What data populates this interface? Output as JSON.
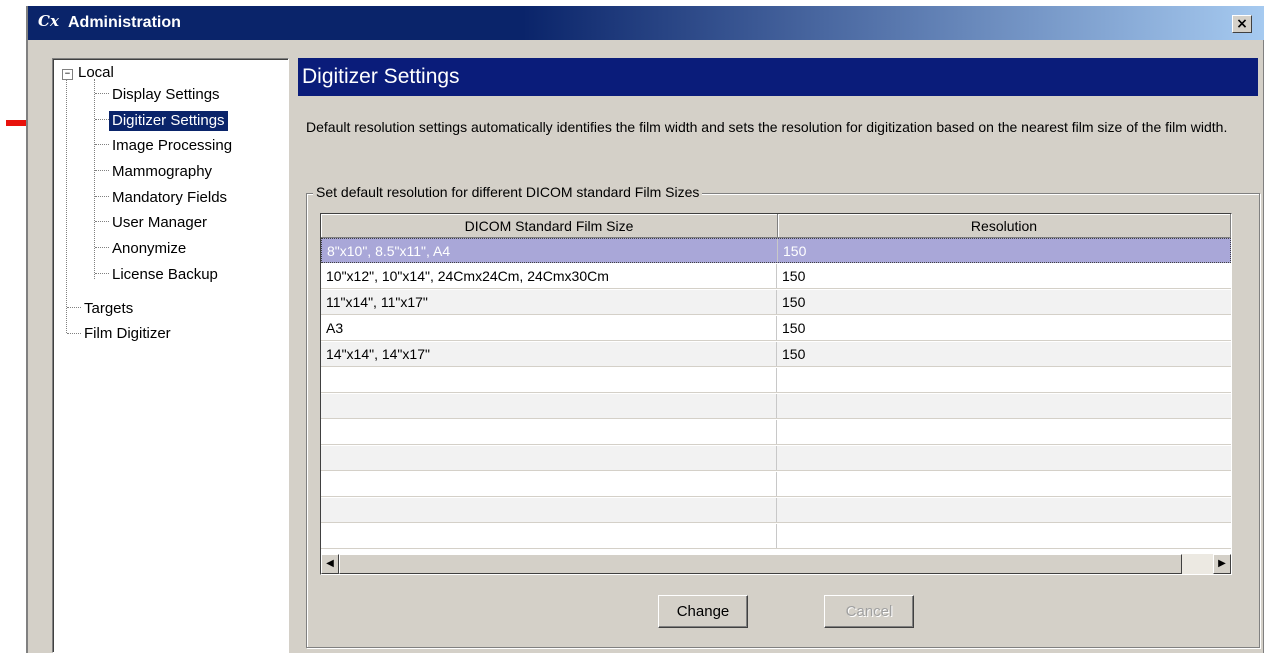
{
  "window": {
    "logo": "Cx",
    "title": "Administration",
    "close_label": "×"
  },
  "tree": {
    "expander": "−",
    "root": "Local",
    "children": [
      "Display Settings",
      "Digitizer Settings",
      "Image Processing",
      "Mammography",
      "Mandatory Fields",
      "User Manager",
      "Anonymize",
      "License Backup"
    ],
    "siblings": [
      "Targets",
      "Film Digitizer"
    ],
    "selected": "Digitizer Settings"
  },
  "panel": {
    "title": "Digitizer Settings",
    "description": "Default resolution settings automatically identifies the film width and sets the resolution for digitization based on the nearest film size of the film width.",
    "group_label": "Set default resolution for different DICOM standard Film Sizes"
  },
  "table": {
    "columns": [
      "DICOM Standard Film Size",
      "Resolution"
    ],
    "rows": [
      [
        "8\"x10\", 8.5\"x11\", A4",
        "150"
      ],
      [
        "10\"x12\", 10\"x14\", 24Cmx24Cm, 24Cmx30Cm",
        "150"
      ],
      [
        "11\"x14\", 11\"x17\"",
        "150"
      ],
      [
        "A3",
        "150"
      ],
      [
        "14\"x14\", 14\"x17\"",
        "150"
      ]
    ],
    "selected_row": 0
  },
  "scrollbar": {
    "left_arrow": "◀",
    "right_arrow": "▶"
  },
  "buttons": {
    "change": "Change",
    "cancel": "Cancel"
  },
  "colors": {
    "arrow": "#e8120c",
    "titlebar": "#0a246a",
    "header_bar": "#0a1c7a",
    "selection": "#a9a7d8"
  }
}
